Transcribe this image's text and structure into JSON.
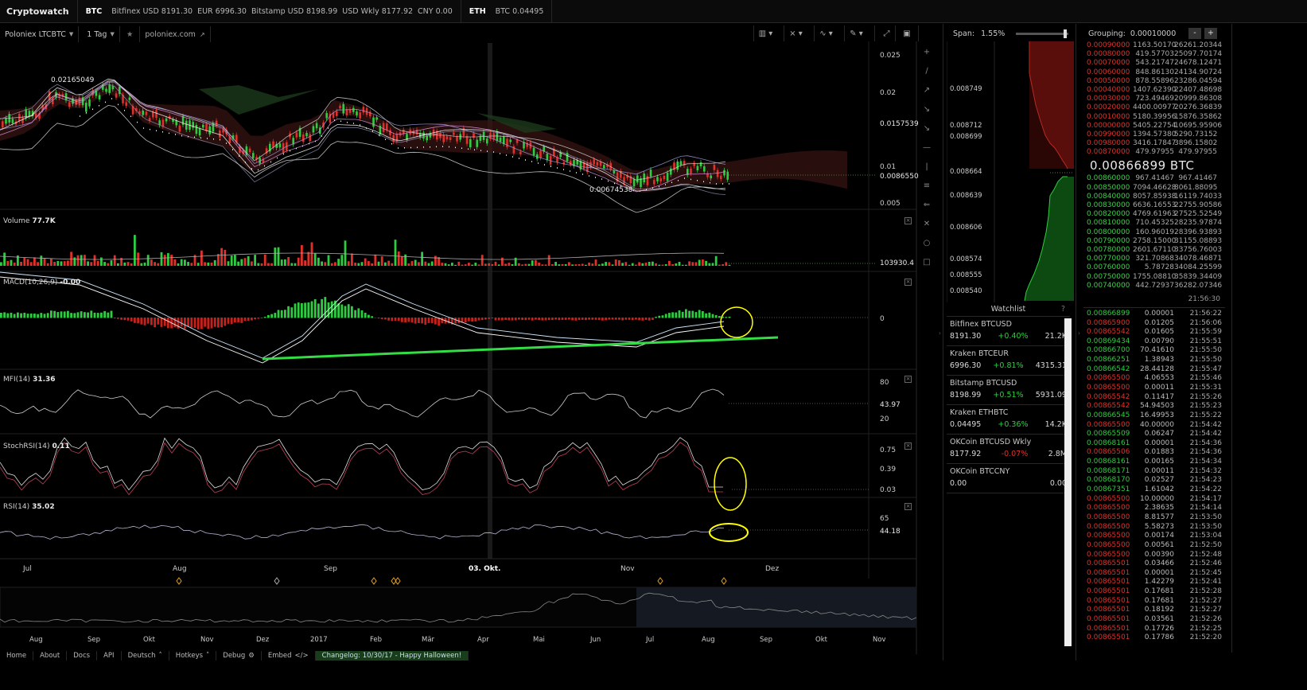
{
  "topbar": {
    "brand": "Cryptowatch",
    "btc": {
      "ticker": "BTC",
      "items": [
        "Bitfinex USD 8191.30",
        "EUR 6996.30",
        "Bitstamp USD 8198.99",
        "USD Wkly 8177.92",
        "CNY 0.00"
      ]
    },
    "eth": {
      "ticker": "ETH",
      "items": [
        "BTC 0.04495"
      ]
    }
  },
  "chart_toolbar": {
    "market": "Poloniex LTCBTC",
    "period": "1 Tag",
    "star_icon": "star-icon",
    "link": "poloniex.com",
    "icons": [
      "candle-type-icon",
      "indicator-icon",
      "line-tool-icon",
      "draw-icon",
      "fullscreen-icon",
      "screenshot-icon"
    ]
  },
  "price_panel": {
    "high_label": "0.02165049",
    "low_label": "0.00674538",
    "y_ticks": [
      "0.025",
      "0.02",
      "0.01",
      "0.005"
    ],
    "current_tag": "0.0157539",
    "last_tag": "0.0086550"
  },
  "volume_panel": {
    "name": "Volume",
    "value": "77.7K",
    "last_tag": "103930.4"
  },
  "macd_panel": {
    "name": "MACD(10,26,9)",
    "value": "-0.00",
    "tick": "0"
  },
  "mfi_panel": {
    "name": "MFI(14)",
    "value": "31.36",
    "ticks": [
      "80",
      "43.97",
      "20"
    ]
  },
  "stochrsi_panel": {
    "name": "StochRSI(14)",
    "value": "0.11",
    "ticks": [
      "0.75",
      "0.39",
      "0.03"
    ]
  },
  "rsi_panel": {
    "name": "RSI(14)",
    "value": "35.02",
    "ticks": [
      "65",
      "44.18"
    ]
  },
  "x_axis": [
    "Jul",
    "Aug",
    "Sep",
    "03. Okt.",
    "Nov",
    "Dez"
  ],
  "nav_axis": [
    "Aug",
    "Sep",
    "Okt",
    "Nov",
    "Dez",
    "2017",
    "Feb",
    "Mär",
    "Apr",
    "Mai",
    "Jun",
    "Jul",
    "Aug",
    "Sep",
    "Okt",
    "Nov"
  ],
  "depth": {
    "span_label": "Span:",
    "span_value": "1.55%",
    "ticks": [
      "0.008749",
      "0.008712",
      "0.008699",
      "0.008664",
      "0.008639",
      "0.008606",
      "0.008574",
      "0.008555",
      "0.008540"
    ]
  },
  "watchlist": {
    "title": "Watchlist",
    "help": "?",
    "items": [
      {
        "name": "Bitfinex BTCUSD",
        "price": "8191.30",
        "change": "+0.40%",
        "volume": "21.2K",
        "dir": "pos"
      },
      {
        "name": "Kraken BTCEUR",
        "price": "6996.30",
        "change": "+0.81%",
        "volume": "4315.31",
        "dir": "pos"
      },
      {
        "name": "Bitstamp BTCUSD",
        "price": "8198.99",
        "change": "+0.51%",
        "volume": "5931.09",
        "dir": "pos"
      },
      {
        "name": "Kraken ETHBTC",
        "price": "0.04495",
        "change": "+0.36%",
        "volume": "14.2K",
        "dir": "pos"
      },
      {
        "name": "OKCoin BTCUSD Wkly",
        "price": "8177.92",
        "change": "-0.07%",
        "volume": "2.8M",
        "dir": "neg"
      },
      {
        "name": "OKCoin BTCCNY",
        "price": "0.00",
        "change": "",
        "volume": "0.00",
        "dir": "pos"
      }
    ]
  },
  "orderbook": {
    "grouping_label": "Grouping:",
    "grouping_value": "0.00010000",
    "minus": "-",
    "plus": "+",
    "spread_price": "0.00866899 BTC",
    "asks": [
      [
        "0.00090000",
        "1163.50170",
        "26261.20344"
      ],
      [
        "0.00080000",
        "419.57703",
        "25097.70174"
      ],
      [
        "0.00070000",
        "543.21747",
        "24678.12471"
      ],
      [
        "0.00060000",
        "848.86130",
        "24134.90724"
      ],
      [
        "0.00050000",
        "878.55896",
        "23286.04594"
      ],
      [
        "0.00040000",
        "1407.62390",
        "22407.48698"
      ],
      [
        "0.00030000",
        "723.49469",
        "20999.86308"
      ],
      [
        "0.00020000",
        "4400.00977",
        "20276.36839"
      ],
      [
        "0.00010000",
        "5180.39956",
        "15876.35862"
      ],
      [
        "0.00000000",
        "5405.22754",
        "10695.95906"
      ],
      [
        "0.00990000",
        "1394.57380",
        "5290.73152"
      ],
      [
        "0.00980000",
        "3416.17847",
        "3896.15802"
      ],
      [
        "0.00870000",
        "479.97955",
        "479.97955"
      ]
    ],
    "bids": [
      [
        "0.00860000",
        "967.41467",
        "967.41467"
      ],
      [
        "0.00850000",
        "7094.46628",
        "8061.88095"
      ],
      [
        "0.00840000",
        "8057.85938",
        "16119.74033"
      ],
      [
        "0.00830000",
        "6636.16553",
        "22755.90586"
      ],
      [
        "0.00820000",
        "4769.61963",
        "27525.52549"
      ],
      [
        "0.00810000",
        "710.45325",
        "28235.97874"
      ],
      [
        "0.00800000",
        "160.96019",
        "28396.93893"
      ],
      [
        "0.00790000",
        "2758.15000",
        "31155.08893"
      ],
      [
        "0.00780000",
        "2601.67110",
        "33756.76003"
      ],
      [
        "0.00770000",
        "321.70868",
        "34078.46871"
      ],
      [
        "0.00760000",
        "5.78728",
        "34084.25599"
      ],
      [
        "0.00750000",
        "1755.08810",
        "35839.34409"
      ],
      [
        "0.00740000",
        "442.72937",
        "36282.07346"
      ]
    ],
    "trades_time": "21:56:30",
    "trades": [
      [
        "0.00866899",
        "0.00001",
        "21:56:22",
        "b"
      ],
      [
        "0.00865900",
        "0.01205",
        "21:56:06",
        "a"
      ],
      [
        "0.00865542",
        "0.01605",
        "21:55:59",
        "a"
      ],
      [
        "0.00869434",
        "0.00790",
        "21:55:51",
        "b"
      ],
      [
        "0.00866700",
        "70.41610",
        "21:55:50",
        "b"
      ],
      [
        "0.00866251",
        "1.38943",
        "21:55:50",
        "b"
      ],
      [
        "0.00866542",
        "28.44128",
        "21:55:47",
        "b"
      ],
      [
        "0.00865500",
        "4.06553",
        "21:55:46",
        "a"
      ],
      [
        "0.00865500",
        "0.00011",
        "21:55:31",
        "a"
      ],
      [
        "0.00865542",
        "0.11417",
        "21:55:26",
        "a"
      ],
      [
        "0.00865542",
        "54.94503",
        "21:55:23",
        "a"
      ],
      [
        "0.00866545",
        "16.49953",
        "21:55:22",
        "b"
      ],
      [
        "0.00865500",
        "40.00000",
        "21:54:42",
        "a"
      ],
      [
        "0.00865509",
        "0.06247",
        "21:54:42",
        "b"
      ],
      [
        "0.00868161",
        "0.00001",
        "21:54:36",
        "b"
      ],
      [
        "0.00865506",
        "0.01883",
        "21:54:36",
        "a"
      ],
      [
        "0.00868161",
        "0.00165",
        "21:54:34",
        "b"
      ],
      [
        "0.00868171",
        "0.00011",
        "21:54:32",
        "b"
      ],
      [
        "0.00868170",
        "0.02527",
        "21:54:23",
        "b"
      ],
      [
        "0.00867351",
        "1.61042",
        "21:54:22",
        "b"
      ],
      [
        "0.00865500",
        "10.00000",
        "21:54:17",
        "a"
      ],
      [
        "0.00865500",
        "2.38635",
        "21:54:14",
        "a"
      ],
      [
        "0.00865500",
        "8.81577",
        "21:53:50",
        "a"
      ],
      [
        "0.00865500",
        "5.58273",
        "21:53:50",
        "a"
      ],
      [
        "0.00865500",
        "0.00174",
        "21:53:04",
        "a"
      ],
      [
        "0.00865500",
        "0.00561",
        "21:52:50",
        "a"
      ],
      [
        "0.00865500",
        "0.00390",
        "21:52:48",
        "a"
      ],
      [
        "0.00865501",
        "0.03466",
        "21:52:46",
        "a"
      ],
      [
        "0.00865501",
        "0.00001",
        "21:52:45",
        "a"
      ],
      [
        "0.00865501",
        "1.42279",
        "21:52:41",
        "a"
      ],
      [
        "0.00865501",
        "0.17681",
        "21:52:28",
        "a"
      ],
      [
        "0.00865501",
        "0.17681",
        "21:52:27",
        "a"
      ],
      [
        "0.00865501",
        "0.18192",
        "21:52:27",
        "a"
      ],
      [
        "0.00865501",
        "0.03561",
        "21:52:26",
        "a"
      ],
      [
        "0.00865501",
        "0.17726",
        "21:52:25",
        "a"
      ],
      [
        "0.00865501",
        "0.17786",
        "21:52:20",
        "a"
      ]
    ]
  },
  "bottombar": {
    "items": [
      "Home",
      "About",
      "Docs",
      "API",
      "Deutsch",
      "Hotkeys",
      "Debug",
      "Embed"
    ],
    "changelog": "Changelog: 10/30/17 - Happy Halloween!"
  },
  "colors": {
    "up": "#2ecc40",
    "down": "#e0302a",
    "annotation": "#ffff00",
    "trend": "#33dd44"
  }
}
